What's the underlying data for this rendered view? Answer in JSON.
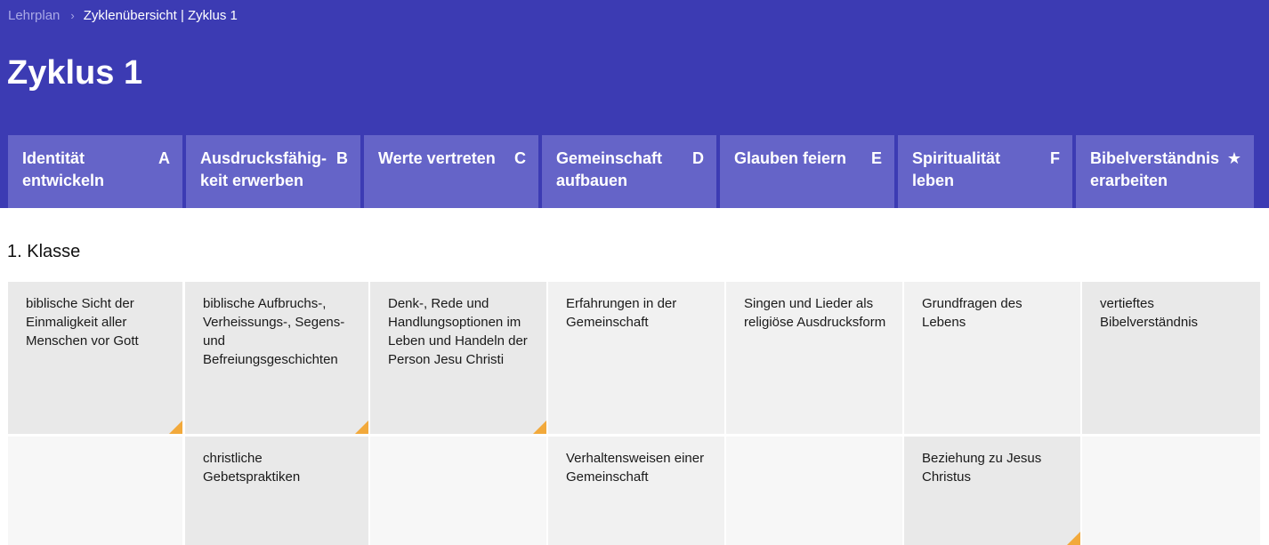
{
  "breadcrumb": {
    "root": "Lehrplan",
    "separator": "›",
    "current": "Zyklenübersicht | Zyklus 1"
  },
  "page_title": "Zyklus 1",
  "tabs": [
    {
      "label": "Identität entwickeln",
      "letter": "A"
    },
    {
      "label": "Ausdrucksfähig-keit erwerben",
      "letter": "B"
    },
    {
      "label": "Werte vertreten",
      "letter": "C"
    },
    {
      "label": "Gemeinschaft aufbauen",
      "letter": "D"
    },
    {
      "label": "Glauben feiern",
      "letter": "E"
    },
    {
      "label": "Spiritualität leben",
      "letter": "F"
    },
    {
      "label": "Bibelverständnis erarbeiten",
      "letter": "★"
    }
  ],
  "section_title": "1. Klasse",
  "cells": {
    "r1c1": "biblische Sicht der Einmaligkeit aller Menschen vor Gott",
    "r1c2": "biblische Aufbruchs-, Verheissungs-, Segens- und Befreiungsgeschichten",
    "r1c3": "Denk-, Rede und Handlungsoptionen im Leben und Handeln der Person Jesu Christi",
    "r1c4": "Erfahrungen in der Gemeinschaft",
    "r1c5": "Singen und Lieder als religiöse Ausdrucksform",
    "r1c6": "Grundfragen des Lebens",
    "r1c7": "vertieftes Bibelverständnis",
    "r2c2": "christliche Gebetspraktiken",
    "r2c4": "Verhaltensweisen einer Gemeinschaft",
    "r2c6": "Beziehung zu Jesus Christus"
  },
  "colors": {
    "header_bg": "#3c3bb3",
    "tab_bg": "#6564c8",
    "corner_accent": "#f2a93b"
  }
}
